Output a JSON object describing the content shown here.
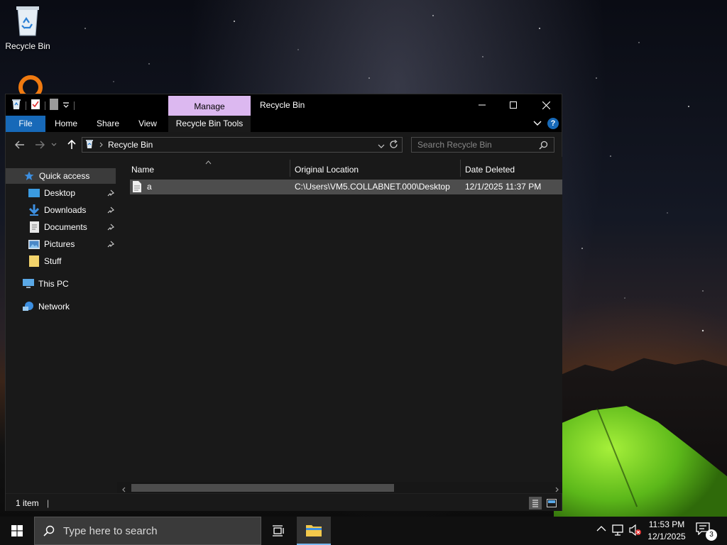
{
  "desktop": {
    "icons": [
      {
        "label": "Recycle Bin",
        "icon": "recycle-bin-icon"
      }
    ]
  },
  "window": {
    "title": "Recycle Bin",
    "context_tab": "Manage",
    "ribbon_tabs": [
      "File",
      "Home",
      "Share",
      "View",
      "Recycle Bin Tools"
    ],
    "address": {
      "path": "Recycle Bin"
    },
    "search": {
      "placeholder": "Search Recycle Bin"
    },
    "nav_pane": [
      {
        "label": "Quick access",
        "icon": "star-icon",
        "pinned": false
      },
      {
        "label": "Desktop",
        "icon": "desktop-folder-icon",
        "pinned": true
      },
      {
        "label": "Downloads",
        "icon": "download-arrow-icon",
        "pinned": true
      },
      {
        "label": "Documents",
        "icon": "documents-icon",
        "pinned": true
      },
      {
        "label": "Pictures",
        "icon": "pictures-icon",
        "pinned": true
      },
      {
        "label": "Stuff",
        "icon": "folder-icon",
        "pinned": false
      },
      {
        "label": "This PC",
        "icon": "computer-icon",
        "pinned": false
      },
      {
        "label": "Network",
        "icon": "network-icon",
        "pinned": false
      }
    ],
    "columns": [
      "Name",
      "Original Location",
      "Date Deleted"
    ],
    "rows": [
      {
        "name": "a",
        "original_location": "C:\\Users\\VM5.COLLABNET.000\\Desktop",
        "date_deleted": "12/1/2025 11:37 PM"
      }
    ],
    "status": {
      "item_count": "1 item"
    }
  },
  "taskbar": {
    "search_placeholder": "Type here to search",
    "clock": {
      "time": "11:53 PM",
      "date": "12/1/2025"
    },
    "notification_count": "3"
  },
  "colors": {
    "file_tab": "#1769b8",
    "manage_tab": "#dcb8f0",
    "selected_row": "#4d4d4d",
    "window_bg": "#191919"
  }
}
